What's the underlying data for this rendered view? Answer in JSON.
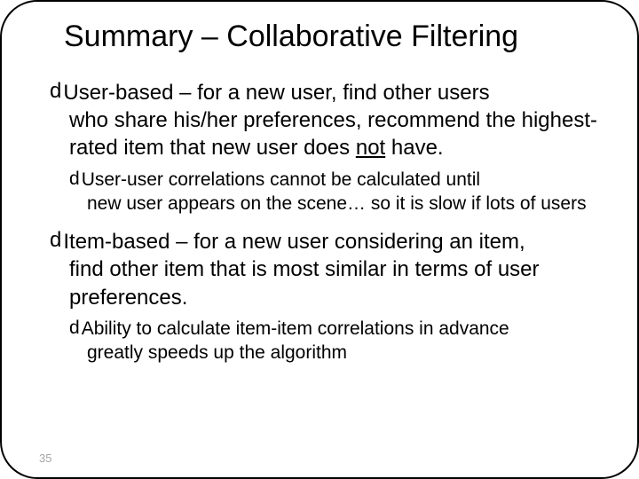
{
  "title": "Summary – Collaborative Filtering",
  "bullet_glyph": "d",
  "items": [
    {
      "lead": "User-based",
      "rest_first": " – for a new user, find other users",
      "cont": "who share his/her preferences, recommend the highest-rated item that new user does ",
      "underlined": "not",
      "after_underlined": " have.",
      "sub": {
        "first": "User-user correlations cannot be calculated until",
        "cont": "new user appears on the scene… so it is slow if lots of users"
      }
    },
    {
      "lead": "Item-based",
      "rest_first": " – for a new user considering an item,",
      "cont": "find other item that is most similar in terms of user preferences.",
      "sub": {
        "first": "Ability to calculate item-item correlations in advance",
        "cont": "greatly speeds up the algorithm"
      }
    }
  ],
  "page_number": "35"
}
